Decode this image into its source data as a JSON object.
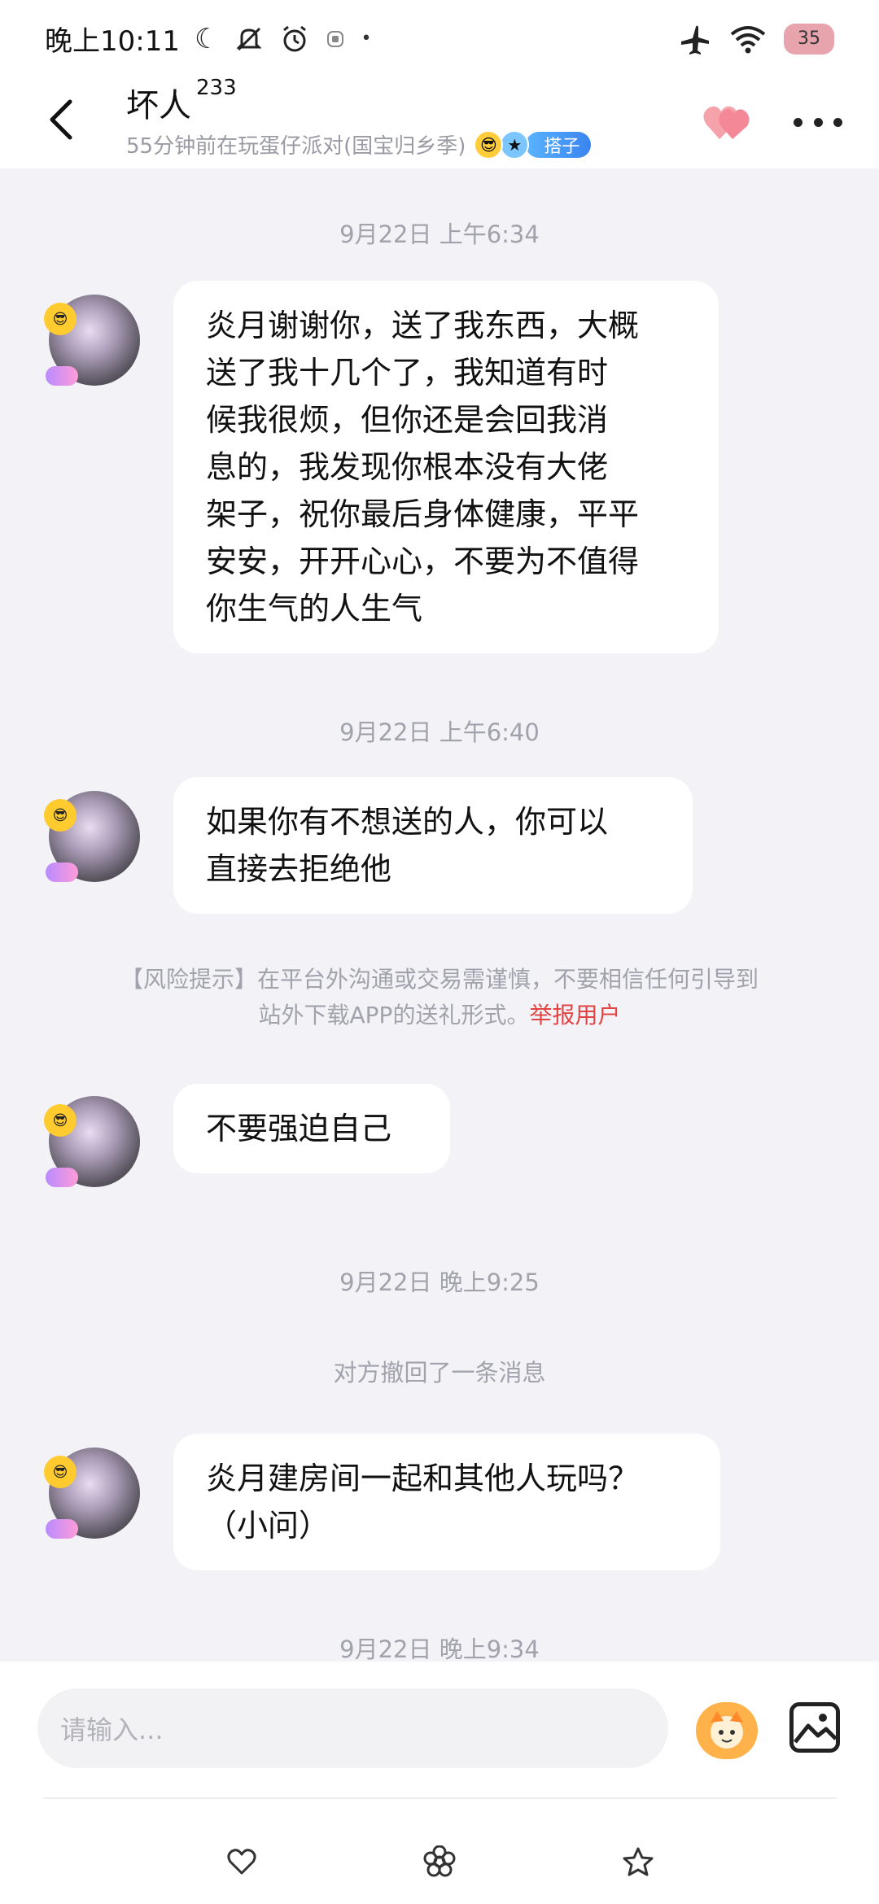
{
  "status_bar": {
    "time": "晚上10:11",
    "battery": "35"
  },
  "header": {
    "name": "坏人",
    "name_sup": "233",
    "activity": "55分钟前在玩蛋仔派对(国宝归乡季)",
    "tag": "搭子"
  },
  "messages": {
    "t1": "9月22日 上午6:34",
    "m1_lines": [
      "炎月谢谢你，送了我东西，大概",
      "送了我十几个了，我知道有时",
      "候我很烦，但你还是会回我消",
      "息的，我发现你根本没有大佬",
      "架子，祝你最后身体健康，平平",
      "安安，开开心心，不要为不值得",
      "你生气的人生气"
    ],
    "t2": "9月22日 上午6:40",
    "m2_lines": [
      "如果你有不想送的人，你可以",
      "直接去拒绝他"
    ],
    "risk_line1": "【风险提示】在平台外沟通或交易需谨慎，不要相信任何引导到",
    "risk_line2": "站外下载APP的送礼形式。",
    "risk_report": "举报用户",
    "m3": "不要强迫自己",
    "t3": "9月22日 晚上9:25",
    "recall": "对方撤回了一条消息",
    "m4_lines": [
      "炎月建房间一起和其他人玩吗？",
      "（小问）"
    ],
    "t4": "9月22日 晚上9:34"
  },
  "input": {
    "placeholder": "请输入..."
  },
  "colors": {
    "background": "#f2f2f7",
    "bubble": "#ffffff",
    "report": "#e24444",
    "tag": "#3a84f0"
  }
}
